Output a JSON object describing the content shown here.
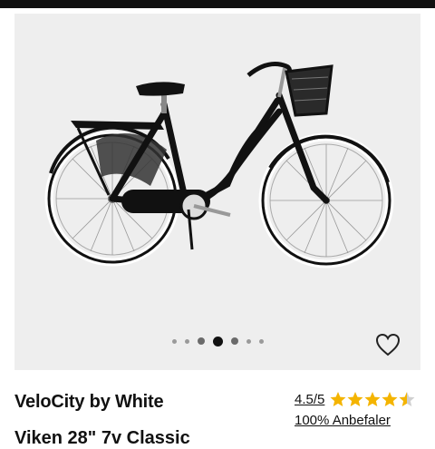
{
  "product": {
    "brand": "VeloCity by White",
    "rating": "4.5/5",
    "rating_value": 4.5,
    "rating_max": 5,
    "recommend": "100% Anbefaler",
    "title_partial": "Viken 28\" 7v Classic"
  },
  "gallery": {
    "image_count": 7,
    "active_index": 3,
    "favorite_icon": "heart-outline-icon"
  },
  "colors": {
    "star": "#f4b400",
    "background_gallery": "#eeeeee",
    "top_bar": "#111111"
  }
}
